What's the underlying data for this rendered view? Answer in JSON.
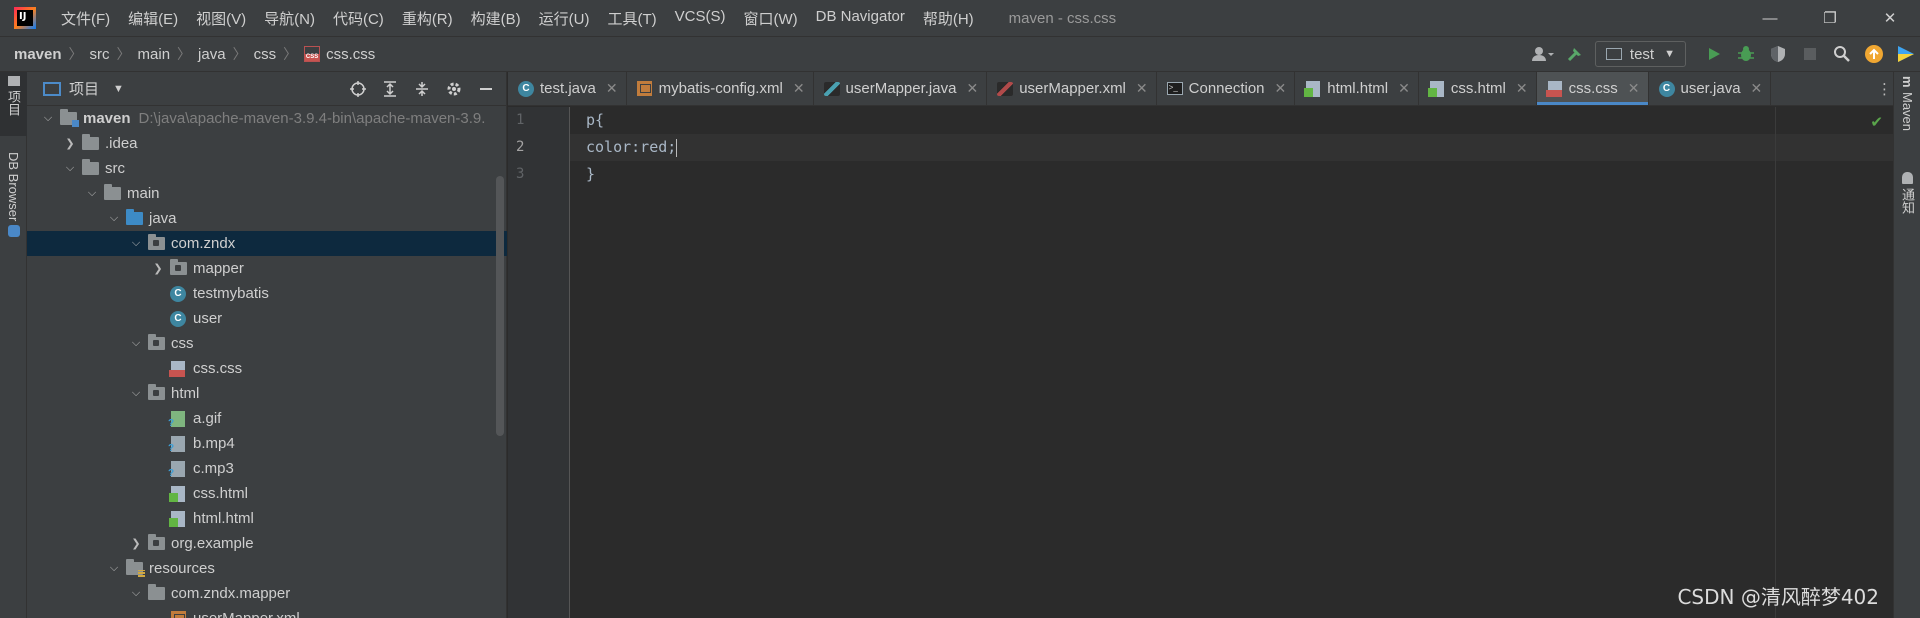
{
  "window": {
    "logo_text": "IJ",
    "title": "maven - css.css",
    "menu": [
      "文件(F)",
      "编辑(E)",
      "视图(V)",
      "导航(N)",
      "代码(C)",
      "重构(R)",
      "构建(B)",
      "运行(U)",
      "工具(T)",
      "VCS(S)",
      "窗口(W)",
      "DB Navigator",
      "帮助(H)"
    ],
    "controls": {
      "minimize": "—",
      "restore": "❐",
      "close": "✕"
    }
  },
  "breadcrumb": [
    "maven",
    "src",
    "main",
    "java",
    "css",
    "css.css"
  ],
  "toolbar": {
    "run_config": "test"
  },
  "left_strip": {
    "project_tab": "项目",
    "db_browser_tab": "DB Browser"
  },
  "project_panel": {
    "title": "项目",
    "tree": [
      {
        "label": "maven",
        "path": "D:\\java\\apache-maven-3.9.4-bin\\apache-maven-3.9.",
        "level": 0,
        "expanded": true,
        "icon": "module-folder-icon",
        "bold": true
      },
      {
        "label": ".idea",
        "level": 1,
        "expanded": false,
        "icon": "folder-icon"
      },
      {
        "label": "src",
        "level": 1,
        "expanded": true,
        "icon": "folder-icon"
      },
      {
        "label": "main",
        "level": 2,
        "expanded": true,
        "icon": "folder-icon"
      },
      {
        "label": "java",
        "level": 3,
        "expanded": true,
        "icon": "source-folder-icon"
      },
      {
        "label": "com.zndx",
        "level": 4,
        "expanded": true,
        "icon": "package-icon",
        "selected": true
      },
      {
        "label": "mapper",
        "level": 5,
        "expanded": false,
        "icon": "package-icon"
      },
      {
        "label": "testmybatis",
        "level": 5,
        "icon": "class-icon"
      },
      {
        "label": "user",
        "level": 5,
        "icon": "class-icon"
      },
      {
        "label": "css",
        "level": 4,
        "expanded": true,
        "icon": "package-icon"
      },
      {
        "label": "css.css",
        "level": 5,
        "icon": "css-file-icon"
      },
      {
        "label": "html",
        "level": 4,
        "expanded": true,
        "icon": "package-icon"
      },
      {
        "label": "a.gif",
        "level": 5,
        "icon": "image-file-icon"
      },
      {
        "label": "b.mp4",
        "level": 5,
        "icon": "unknown-file-icon"
      },
      {
        "label": "c.mp3",
        "level": 5,
        "icon": "unknown-file-icon"
      },
      {
        "label": "css.html",
        "level": 5,
        "icon": "html-file-icon"
      },
      {
        "label": "html.html",
        "level": 5,
        "icon": "html-file-icon"
      },
      {
        "label": "org.example",
        "level": 4,
        "expanded": false,
        "icon": "package-icon"
      },
      {
        "label": "resources",
        "level": 3,
        "expanded": true,
        "icon": "resources-folder-icon"
      },
      {
        "label": "com.zndx.mapper",
        "level": 4,
        "expanded": true,
        "icon": "folder-icon"
      },
      {
        "label": "userMapper.xml",
        "level": 5,
        "icon": "xml-file-icon"
      }
    ]
  },
  "tabs": [
    {
      "label": "test.java",
      "icon": "class-icon"
    },
    {
      "label": "mybatis-config.xml",
      "icon": "xml-file-icon"
    },
    {
      "label": "userMapper.java",
      "icon": "mybatis-java-icon"
    },
    {
      "label": "userMapper.xml",
      "icon": "mybatis-xml-icon"
    },
    {
      "label": "Connection",
      "icon": "console-icon"
    },
    {
      "label": "html.html",
      "icon": "html-file-icon"
    },
    {
      "label": "css.html",
      "icon": "html-file-icon"
    },
    {
      "label": "css.css",
      "icon": "css-file-icon",
      "active": true
    },
    {
      "label": "user.java",
      "icon": "class-icon"
    }
  ],
  "editor": {
    "lines": [
      {
        "no": "1",
        "text": "p{"
      },
      {
        "no": "2",
        "text": "color:red;",
        "current": true
      },
      {
        "no": "3",
        "text": "}"
      }
    ]
  },
  "right_strip": {
    "maven_tab": "Maven",
    "notifications_tab": "通知"
  },
  "watermark": "CSDN @清风醉梦402",
  "colors": {
    "accent": "#4a88c7",
    "background": "#2b2b2b",
    "panel": "#3c3f41",
    "selection": "#0d293e",
    "ok": "#5aa54b"
  }
}
